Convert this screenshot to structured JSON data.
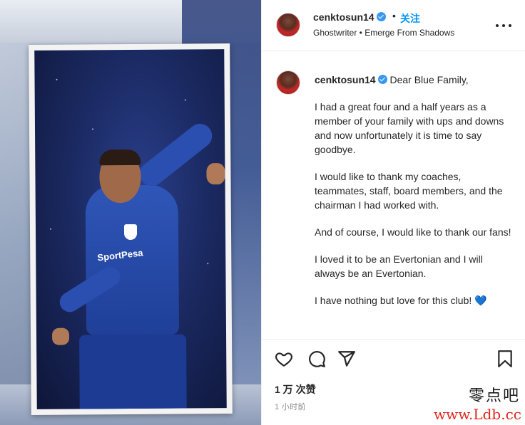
{
  "media": {
    "sponsor_text": "SportPesa"
  },
  "header": {
    "username": "cenktosun14",
    "separator": "•",
    "follow_label": "关注",
    "audio": "Ghostwriter • Emerge From Shadows"
  },
  "caption": {
    "username": "cenktosun14",
    "paragraphs": [
      "Dear Blue Family,",
      "I had a great four and a half years as a member of your family with ups and downs and now unfortunately it is time to say goodbye.",
      "I would like to thank my coaches, teammates, staff, board members, and the chairman I had worked with.",
      "And of course, I would like to thank our fans!",
      "I loved it to be an Evertonian and I will always be an Evertonian.",
      "I have nothing but love for this club! 💙"
    ]
  },
  "actions": {
    "like": "heart-icon",
    "comment": "comment-icon",
    "share": "send-icon",
    "save": "bookmark-icon"
  },
  "likes_text": "1 万 次赞",
  "time_text": "1 小时前",
  "watermark": {
    "cn": "零点吧",
    "url": "www.Ldb.cc"
  },
  "colors": {
    "accent": "#0095f6",
    "verified": "#3897f0",
    "watermark_url": "#e0281e"
  }
}
